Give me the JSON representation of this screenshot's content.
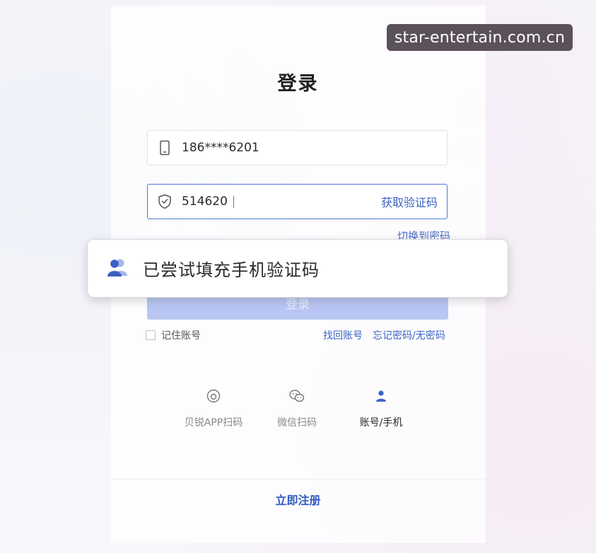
{
  "watermark": "star-entertain.com.cn",
  "login": {
    "title": "登录",
    "phone_value": "186****6201",
    "code_value": "514620",
    "get_code_label": "获取验证码",
    "switch_label": "切换到密码",
    "login_button": "登录",
    "remember_label": "记住账号",
    "find_account": "找回账号",
    "forgot_password": "忘记密码/无密码"
  },
  "methods": [
    {
      "label": "贝锐APP扫码",
      "icon": "scan-app-icon"
    },
    {
      "label": "微信扫码",
      "icon": "wechat-icon"
    },
    {
      "label": "账号/手机",
      "icon": "user-icon"
    }
  ],
  "register_label": "立即注册",
  "toast": {
    "text": "已尝试填充手机验证码",
    "icon": "users-icon"
  },
  "colors": {
    "accent": "#3a63c4",
    "button_disabled": "#b9c6f3",
    "watermark_bg": "#5b5159"
  }
}
